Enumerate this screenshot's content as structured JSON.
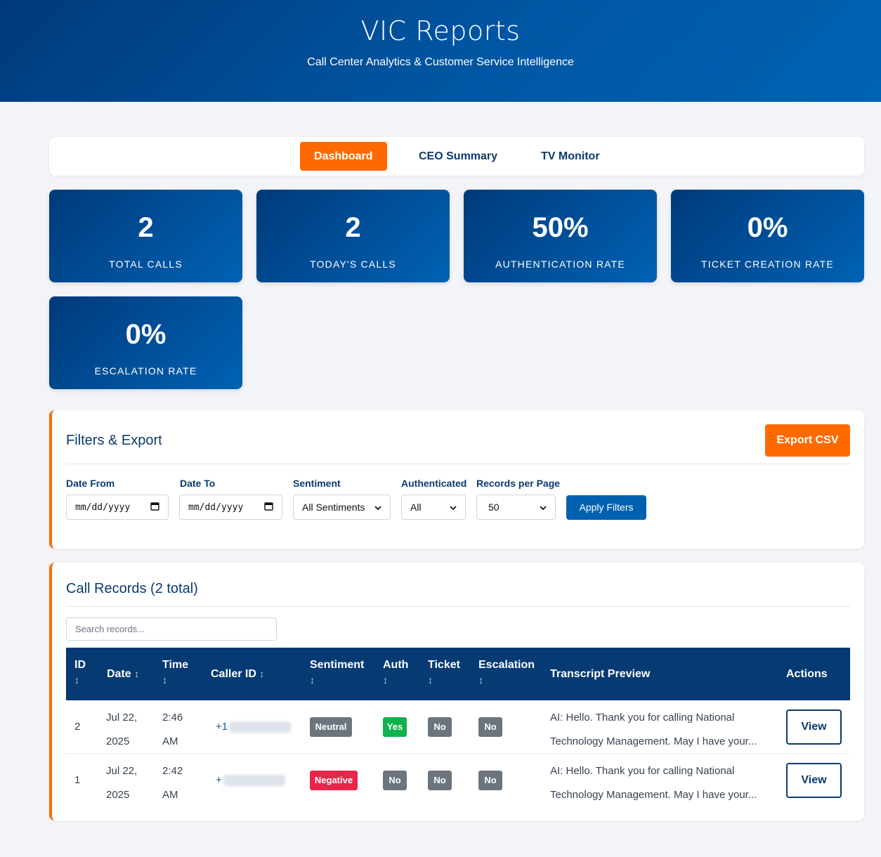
{
  "header": {
    "title": "VIC Reports",
    "subtitle": "Call Center Analytics & Customer Service Intelligence"
  },
  "nav": {
    "tabs": [
      {
        "label": "Dashboard",
        "active": true
      },
      {
        "label": "CEO Summary",
        "active": false
      },
      {
        "label": "TV Monitor",
        "active": false
      }
    ]
  },
  "stats": [
    {
      "value": "2",
      "label": "TOTAL CALLS"
    },
    {
      "value": "2",
      "label": "TODAY'S CALLS"
    },
    {
      "value": "50%",
      "label": "AUTHENTICATION RATE"
    },
    {
      "value": "0%",
      "label": "TICKET CREATION RATE"
    },
    {
      "value": "0%",
      "label": "ESCALATION RATE"
    }
  ],
  "filters": {
    "title": "Filters & Export",
    "export_label": "Export CSV",
    "date_from_label": "Date From",
    "date_from_placeholder": "mm/dd/yyyy",
    "date_to_label": "Date To",
    "date_to_placeholder": "mm/dd/yyyy",
    "sentiment_label": "Sentiment",
    "sentiment_value": "All Sentiments",
    "auth_label": "Authenticated",
    "auth_value": "All",
    "per_page_label": "Records per Page",
    "per_page_value": "50",
    "apply_label": "Apply Filters"
  },
  "records": {
    "title": "Call Records (2 total)",
    "search_placeholder": "Search records...",
    "columns": {
      "id": "ID",
      "date": "Date",
      "time": "Time",
      "caller": "Caller ID",
      "sentiment": "Sentiment",
      "auth": "Auth",
      "ticket": "Ticket",
      "escalation": "Escalation",
      "transcript": "Transcript Preview",
      "actions": "Actions"
    },
    "sort_arrow": "↕",
    "rows": [
      {
        "id": "2",
        "date_1": "Jul 22,",
        "date_2": "2025",
        "time_1": "2:46",
        "time_2": "AM",
        "caller": "+1",
        "sentiment": "Neutral",
        "auth": "Yes",
        "ticket": "No",
        "escalation": "No",
        "transcript_1": "AI: Hello. Thank you for calling National",
        "transcript_2": "Technology Management. May I have your...",
        "action": "View"
      },
      {
        "id": "1",
        "date_1": "Jul 22,",
        "date_2": "2025",
        "time_1": "2:42",
        "time_2": "AM",
        "caller": "+",
        "sentiment": "Negative",
        "auth": "No",
        "ticket": "No",
        "escalation": "No",
        "transcript_1": "AI: Hello. Thank you for calling National",
        "transcript_2": "Technology Management. May I have your...",
        "action": "View"
      }
    ]
  },
  "colors": {
    "brand_blue": "#003a7a",
    "accent_orange": "#ff6a00",
    "positive": "#10b24c",
    "negative": "#e8264a",
    "neutral": "#6c757d"
  },
  "icons": {
    "date_picker": "calendar-icon",
    "select": "chevron-down-icon",
    "sort": "sort-arrows-icon"
  }
}
